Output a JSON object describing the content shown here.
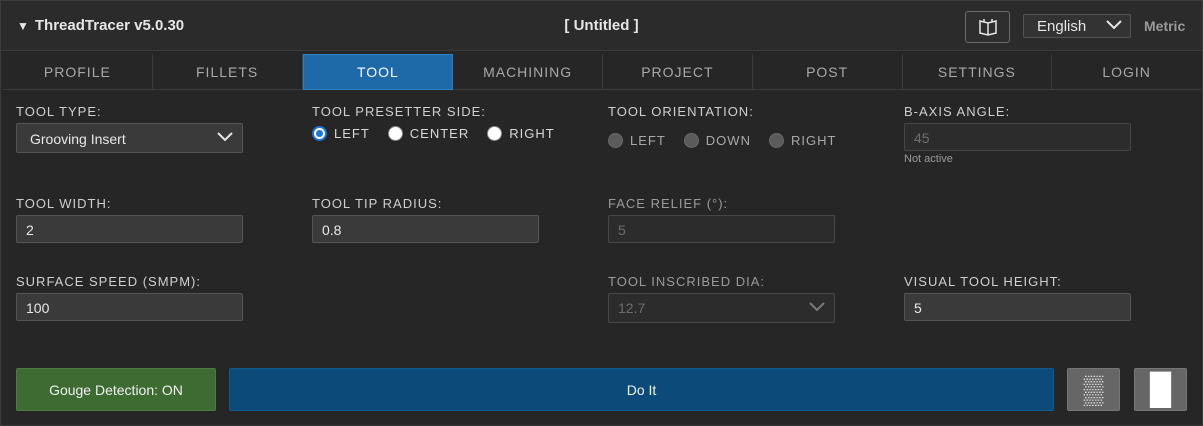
{
  "header": {
    "app_title": "ThreadTracer v5.0.30",
    "collapse_glyph": "▼",
    "doc_title": "[ Untitled ]",
    "language": "English",
    "units": "Metric",
    "help_icon": "book-icon"
  },
  "tabs": [
    {
      "label": "PROFILE",
      "active": false
    },
    {
      "label": "FILLETS",
      "active": false
    },
    {
      "label": "TOOL",
      "active": true
    },
    {
      "label": "MACHINING",
      "active": false
    },
    {
      "label": "PROJECT",
      "active": false
    },
    {
      "label": "POST",
      "active": false
    },
    {
      "label": "SETTINGS",
      "active": false
    },
    {
      "label": "LOGIN",
      "active": false
    }
  ],
  "tool": {
    "tool_type": {
      "label": "TOOL TYPE:",
      "value": "Grooving Insert"
    },
    "presetter_side": {
      "label": "TOOL PRESETTER SIDE:",
      "options": [
        "LEFT",
        "CENTER",
        "RIGHT"
      ],
      "selected": "LEFT"
    },
    "orientation": {
      "label": "TOOL ORIENTATION:",
      "options": [
        "LEFT",
        "DOWN",
        "RIGHT"
      ],
      "enabled": false
    },
    "b_axis_angle": {
      "label": "B-AXIS ANGLE:",
      "value": "45",
      "note": "Not active"
    },
    "tool_width": {
      "label": "TOOL WIDTH:",
      "value": "2"
    },
    "tip_radius": {
      "label": "TOOL TIP RADIUS:",
      "value": "0.8"
    },
    "face_relief": {
      "label": "FACE RELIEF (°):",
      "value": "5"
    },
    "surface_speed": {
      "label": "SURFACE SPEED (SMPM):",
      "value": "100"
    },
    "inscribed_dia": {
      "label": "TOOL INSCRIBED DIA:",
      "value": "12.7"
    },
    "visual_height": {
      "label": "VISUAL TOOL HEIGHT:",
      "value": "5"
    }
  },
  "actions": {
    "gouge": "Gouge Detection: ON",
    "do_it": "Do It",
    "pattern_glyph": "▒",
    "panel_glyph": "█"
  },
  "colors": {
    "active_tab": "#1e69a8",
    "gouge_btn": "#3d6b32",
    "do_it_btn": "#0c4b79"
  }
}
